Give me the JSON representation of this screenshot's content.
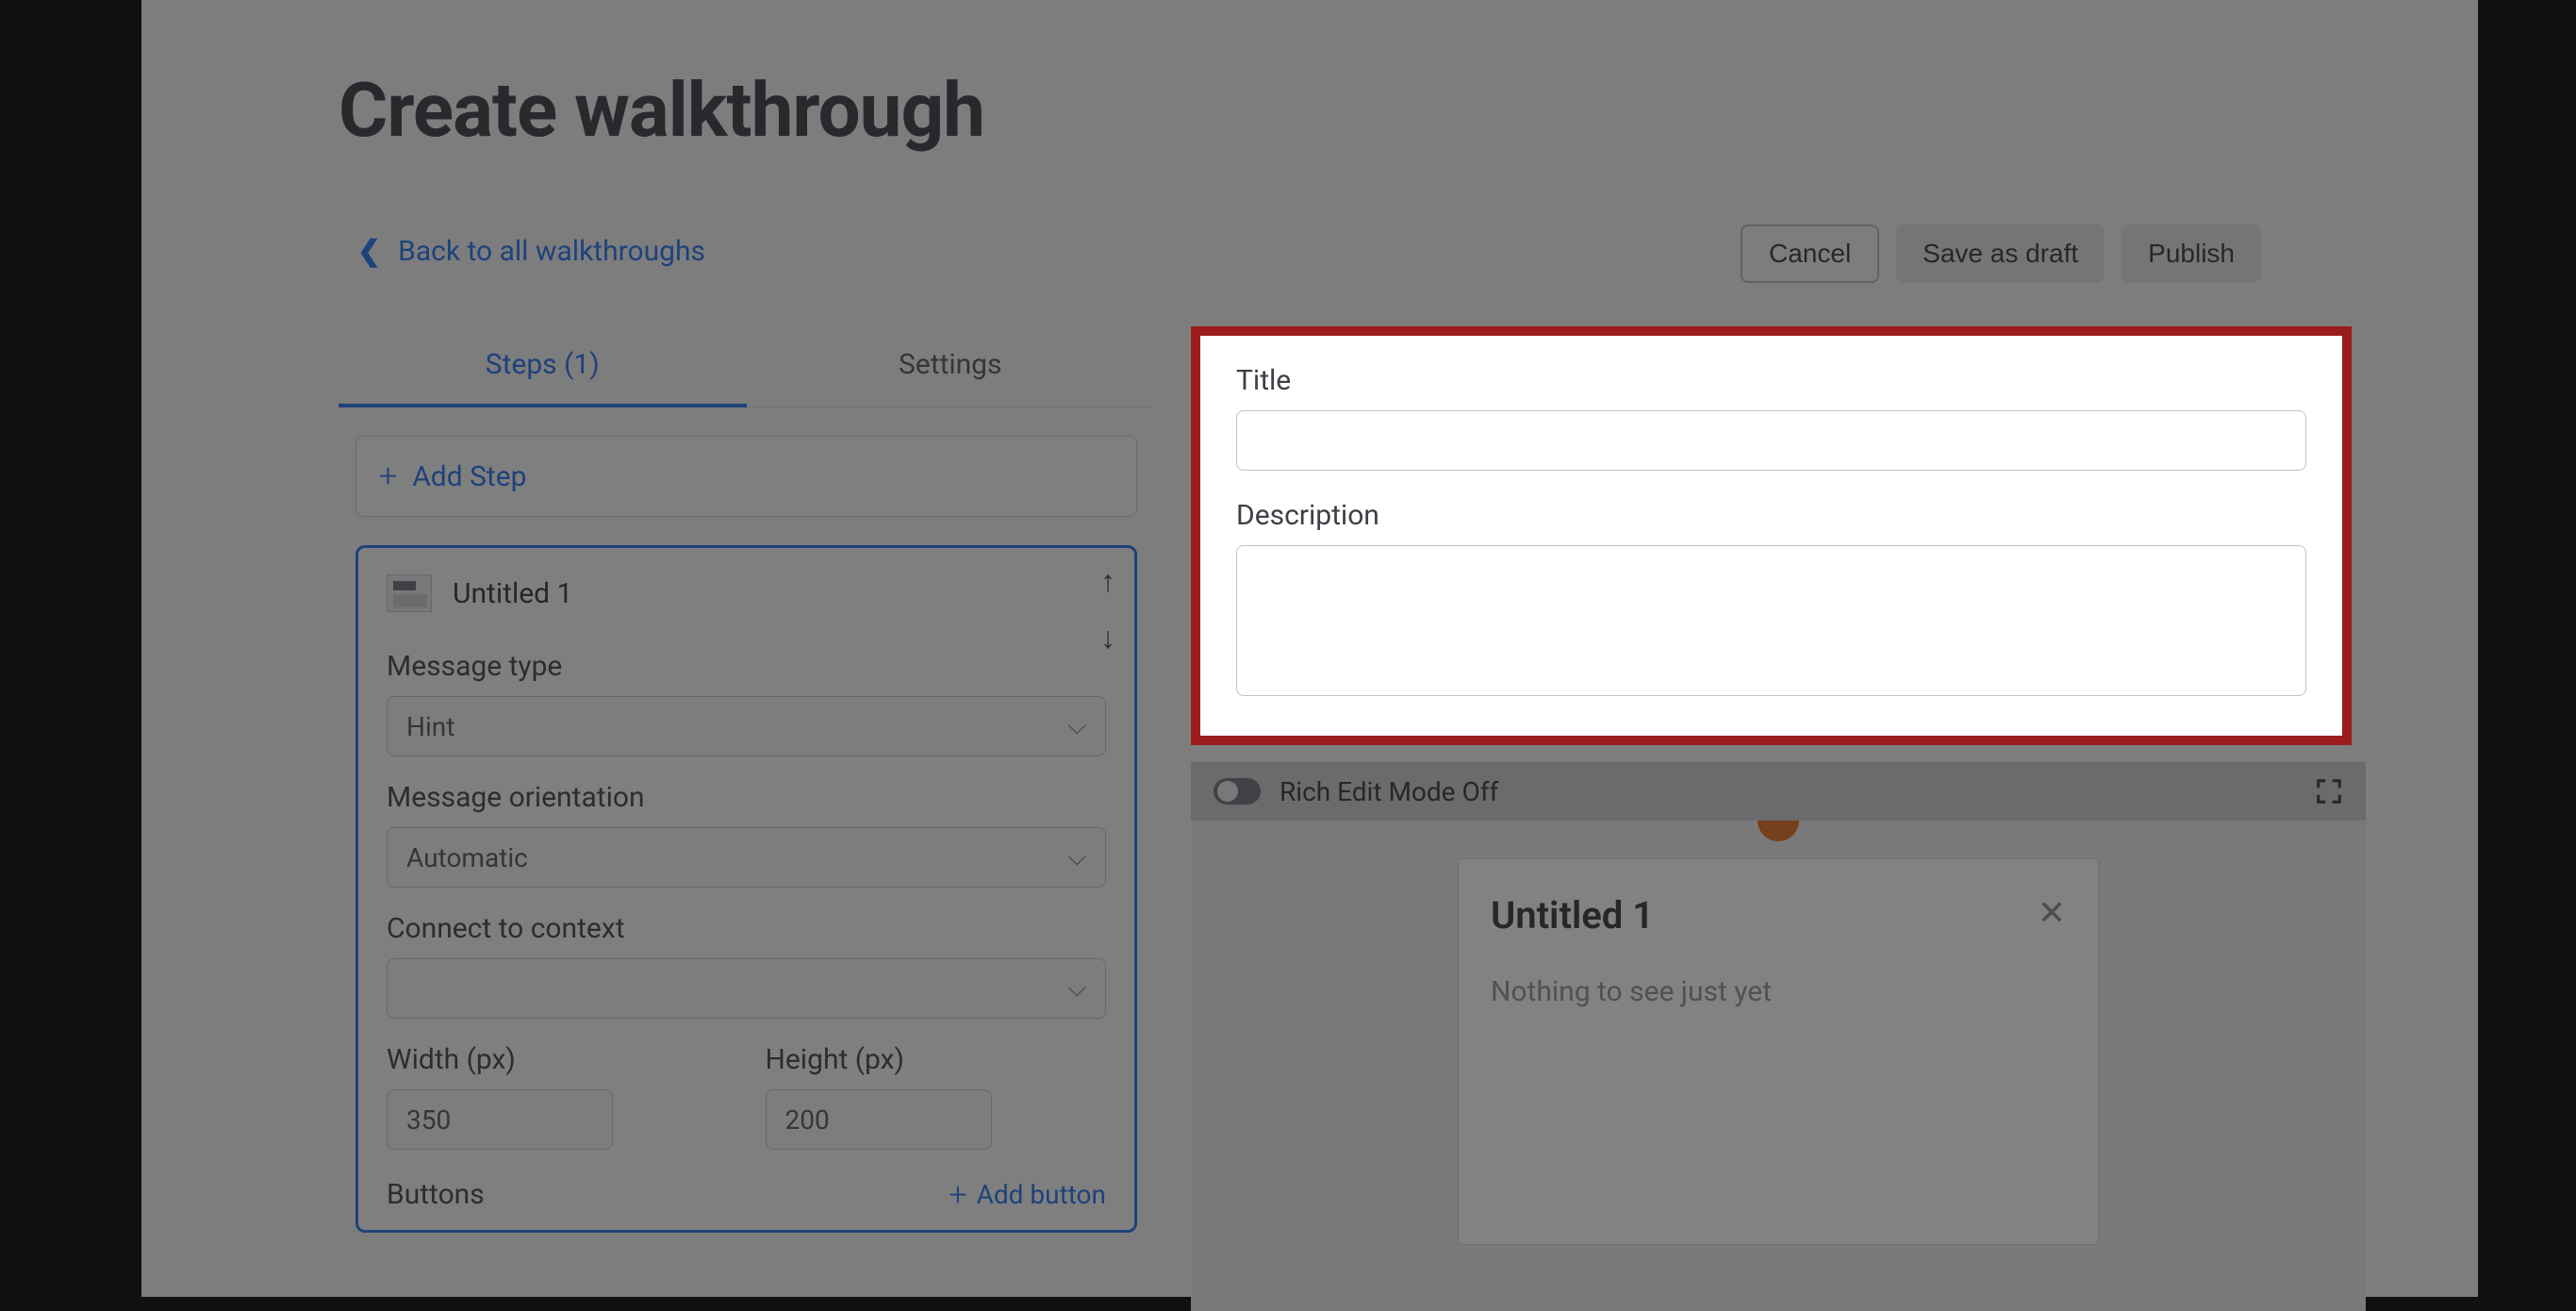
{
  "page": {
    "title": "Create walkthrough",
    "back_link": "Back to all walkthroughs"
  },
  "actions": {
    "cancel": "Cancel",
    "save_draft": "Save as draft",
    "publish": "Publish"
  },
  "tabs": {
    "steps": "Steps (1)",
    "settings": "Settings"
  },
  "sidebar": {
    "add_step": "Add Step",
    "step": {
      "title": "Untitled 1",
      "message_type_label": "Message type",
      "message_type_value": "Hint",
      "orientation_label": "Message orientation",
      "orientation_value": "Automatic",
      "context_label": "Connect to context",
      "context_value": "",
      "width_label": "Width (px)",
      "width_value": "350",
      "height_label": "Height (px)",
      "height_value": "200",
      "buttons_label": "Buttons",
      "add_button_label": "Add button"
    }
  },
  "form": {
    "title_label": "Title",
    "title_value": "",
    "description_label": "Description",
    "description_value": ""
  },
  "richbar": {
    "label": "Rich Edit Mode Off"
  },
  "preview": {
    "popover_title": "Untitled 1",
    "popover_body": "Nothing to see just yet"
  }
}
